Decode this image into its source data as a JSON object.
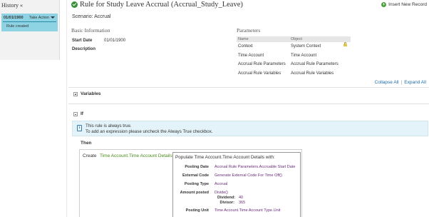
{
  "history": {
    "title": "History «",
    "entry": {
      "date": "01/01/1900",
      "action_label": "Take Action",
      "status": "Rule created"
    }
  },
  "header": {
    "title": "Rule for Study Leave Accrual (Accrual_Study_Leave)",
    "insert_label": "Insert New Record",
    "scenario": "Scenario: Accrual"
  },
  "basic_info": {
    "heading": "Basic Information",
    "start_date_label": "Start Date",
    "start_date_value": "01/01/1900",
    "description_label": "Description"
  },
  "parameters": {
    "heading": "Parameters",
    "columns": [
      "Name",
      "Object"
    ],
    "rows": [
      {
        "name": "Context",
        "object": "System Context",
        "locked": true
      },
      {
        "name": "Time Account",
        "object": "Time Account"
      },
      {
        "name": "Accrual Rule Parameters",
        "object": "Accrual Rule Parameters"
      },
      {
        "name": "Accrual Rule Variables",
        "object": "Accrual Rule Variables"
      }
    ]
  },
  "links": {
    "collapse_all": "Collapse All",
    "separator": "|",
    "expand_all": "Expand All"
  },
  "variables_label": "Variables",
  "if_label": "If",
  "info_banner": {
    "line1": "This rule is always true.",
    "line2": "To add an expression please uncheck the Always True checkbox."
  },
  "then_label": "Then",
  "action": {
    "create_label": "Create",
    "target": "Time Account.Time Account Details",
    "populate_title": "Populate Time Account.Time Account Details with:",
    "fields": [
      {
        "label": "Posting Date",
        "value": "Accrual Rule Parameters.Accruable Start Date"
      },
      {
        "label": "External Code",
        "value": "Generate External Code For Time Off()"
      },
      {
        "label": "Posting Type",
        "value": "Accrual"
      },
      {
        "label": "Amount posted",
        "value": "Divide()"
      },
      {
        "label": "Posting Unit",
        "value": "Time Account.Time Account Type.Unit"
      }
    ],
    "divide": {
      "dividend_label": "Dividend:",
      "dividend_value": "40",
      "divisor_label": "Divisor:",
      "divisor_value": "365"
    }
  },
  "colors": {
    "history_card": "#8ed3e4",
    "check": "#3a8f3a",
    "link": "#1f6ea8",
    "create_target": "#4a8a1c",
    "field_value": "#6a2c7a",
    "info_banner": "#e4f3f9"
  },
  "icons": [
    "check-circle-icon",
    "plus-circle-icon",
    "lock-icon",
    "info-icon",
    "expand-toggle-icon",
    "collapse-toggle-icon",
    "caret-down-icon"
  ]
}
